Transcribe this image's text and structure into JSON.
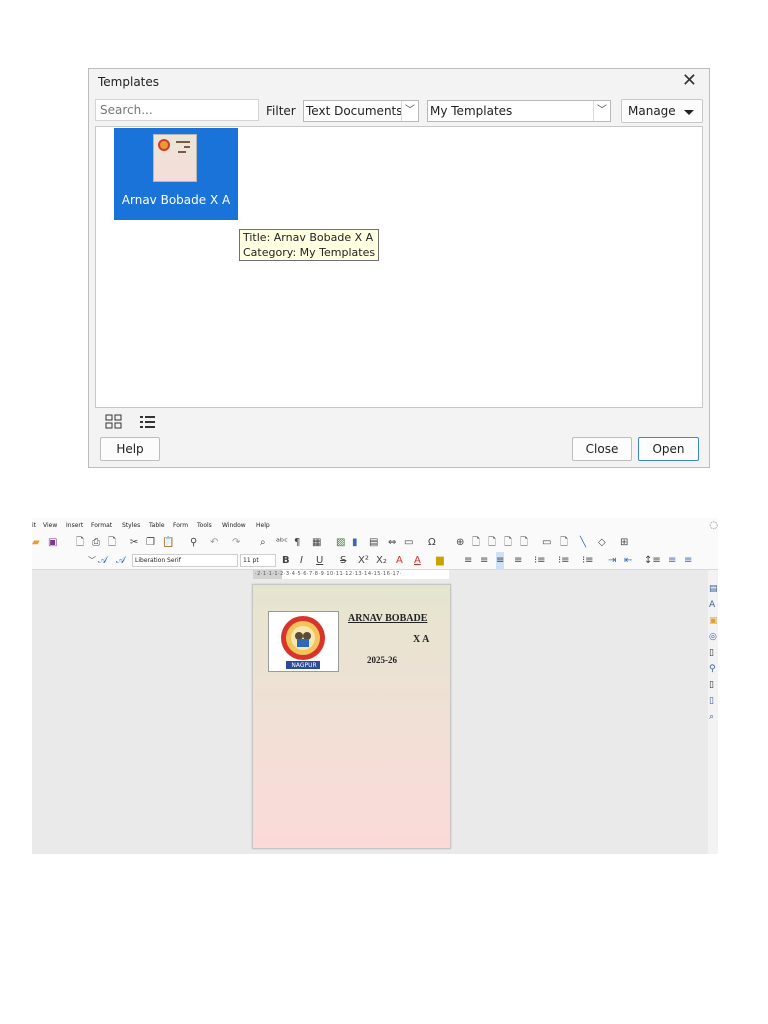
{
  "dialog": {
    "title": "Templates",
    "close_glyph": "✕",
    "search_placeholder": "Search...",
    "filter_label": "Filter",
    "filter_value": "Text Documents",
    "category_value": "My Templates",
    "manage_label": "Manage",
    "template": {
      "name": "Arnav Bobade X A",
      "tooltip_title": "Title: Arnav Bobade X A",
      "tooltip_category": "Category: My Templates"
    },
    "help_label": "Help",
    "close_label": "Close",
    "open_label": "Open",
    "accent_color": "#1a73d9"
  },
  "writer": {
    "menu": [
      "it",
      "View",
      "Insert",
      "Format",
      "Styles",
      "Table",
      "Form",
      "Tools",
      "Window",
      "Help"
    ],
    "font_name": "Liberation Serif",
    "font_size": "11 pt",
    "ruler_text": "·2·1·1·1·2·3·4·5·6·7·8·9·10·11·12·13·14·15·16·17·",
    "document": {
      "name": "ARNAV BOBADE",
      "class": "X A",
      "year": "2025-26",
      "logo_caption": "NAGPUR",
      "logo_ring_text": "SAWHAR HIGH SCHOOL"
    }
  }
}
